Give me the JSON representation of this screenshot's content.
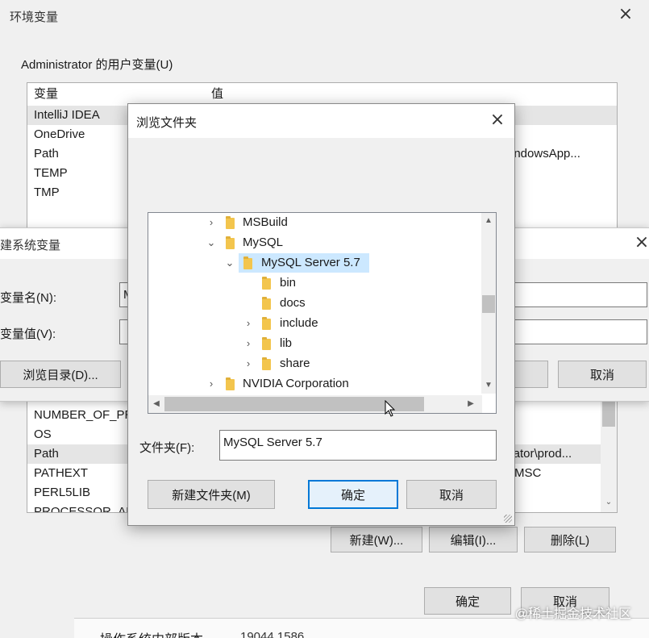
{
  "env_window": {
    "title": "环境变量",
    "user_vars_label": "Administrator 的用户变量(U)",
    "columns": [
      "变量",
      "值"
    ],
    "user_vars": [
      {
        "name": "IntelliJ IDEA",
        "value": ""
      },
      {
        "name": "OneDrive",
        "value": ""
      },
      {
        "name": "Path",
        "value": "indowsApp..."
      },
      {
        "name": "TEMP",
        "value": ""
      },
      {
        "name": "TMP",
        "value": ""
      }
    ],
    "sys_vars": [
      {
        "name": "NUMBER_OF_PR",
        "value": ""
      },
      {
        "name": "OS",
        "value": ""
      },
      {
        "name": "Path",
        "value": "strator\\prod..."
      },
      {
        "name": "PATHEXT",
        "value": "MSC"
      },
      {
        "name": "PERL5LIB",
        "value": ""
      },
      {
        "name": "PROCESSOR_AR",
        "value": ""
      }
    ],
    "new_button": "新建(W)...",
    "edit_button": "编辑(I)...",
    "delete_button": "删除(L)",
    "ok_button": "确定",
    "cancel_button": "取消",
    "footer_label": "操作系统内部版本",
    "footer_value": "19044.1586"
  },
  "newvar_window": {
    "title": "建系统变量",
    "name_label": "变量名(N):",
    "name_value": "M",
    "value_label": "变量值(V):",
    "value_value": "",
    "browse_dir_button": "浏览目录(D)...",
    "cancel_button": "取消"
  },
  "browse_window": {
    "title": "浏览文件夹",
    "tree": [
      {
        "label": "MSBuild",
        "chevron": "›"
      },
      {
        "label": "MySQL",
        "chevron": "⌄"
      },
      {
        "label": "MySQL Server 5.7",
        "chevron": "⌄"
      },
      {
        "label": "bin",
        "chevron": ""
      },
      {
        "label": "docs",
        "chevron": ""
      },
      {
        "label": "include",
        "chevron": "›"
      },
      {
        "label": "lib",
        "chevron": "›"
      },
      {
        "label": "share",
        "chevron": "›"
      },
      {
        "label": "NVIDIA Corporation",
        "chevron": "›"
      }
    ],
    "folder_label": "文件夹(F):",
    "folder_value": "MySQL Server 5.7",
    "new_folder_button": "新建文件夹(M)",
    "ok_button": "确定",
    "cancel_button": "取消"
  },
  "watermark": "@稀土掘金技术社区",
  "colors": {
    "selection": "#cce8ff",
    "accent": "#0078d7",
    "folder": "#f3c54d"
  }
}
